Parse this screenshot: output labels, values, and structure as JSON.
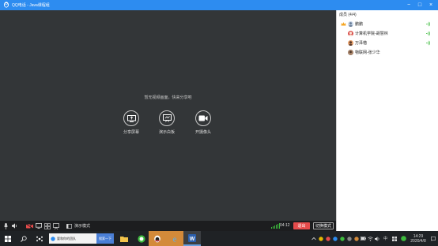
{
  "window": {
    "title": "QQ电话 - Java课程组",
    "controls": [
      "−",
      "□",
      "×"
    ]
  },
  "main": {
    "empty_hint": "暂无视频画面，快来分享吧",
    "actions": [
      {
        "label": "分享屏幕",
        "icon": "screen-share-icon"
      },
      {
        "label": "演示白板",
        "icon": "whiteboard-icon"
      },
      {
        "label": "开摄像头",
        "icon": "camera-icon"
      }
    ]
  },
  "controlbar": {
    "collapse_label": "演示模式",
    "timer": "04:12",
    "exit_label": "退出",
    "switch_label": "切换模式"
  },
  "panel": {
    "header": "成员 (4/4)",
    "members": [
      {
        "name": "鹏鹏",
        "owner": true,
        "speaking": true
      },
      {
        "name": "计算机学院-胡慧林",
        "owner": false,
        "speaking": true
      },
      {
        "name": "万泽楷",
        "owner": false,
        "speaking": true
      },
      {
        "name": "物联网-张少华",
        "owner": false,
        "speaking": false
      }
    ]
  },
  "taskbar": {
    "browser_tab_title": "要和你的团队",
    "browser_tab_action": "搜索一下",
    "ime": "中",
    "time": "14:29",
    "date": "2020/4/8"
  },
  "colors": {
    "titlebar": "#2d8cf0",
    "main_bg": "#333638",
    "exit": "#e54b4b",
    "signal": "#3dbb3d"
  }
}
